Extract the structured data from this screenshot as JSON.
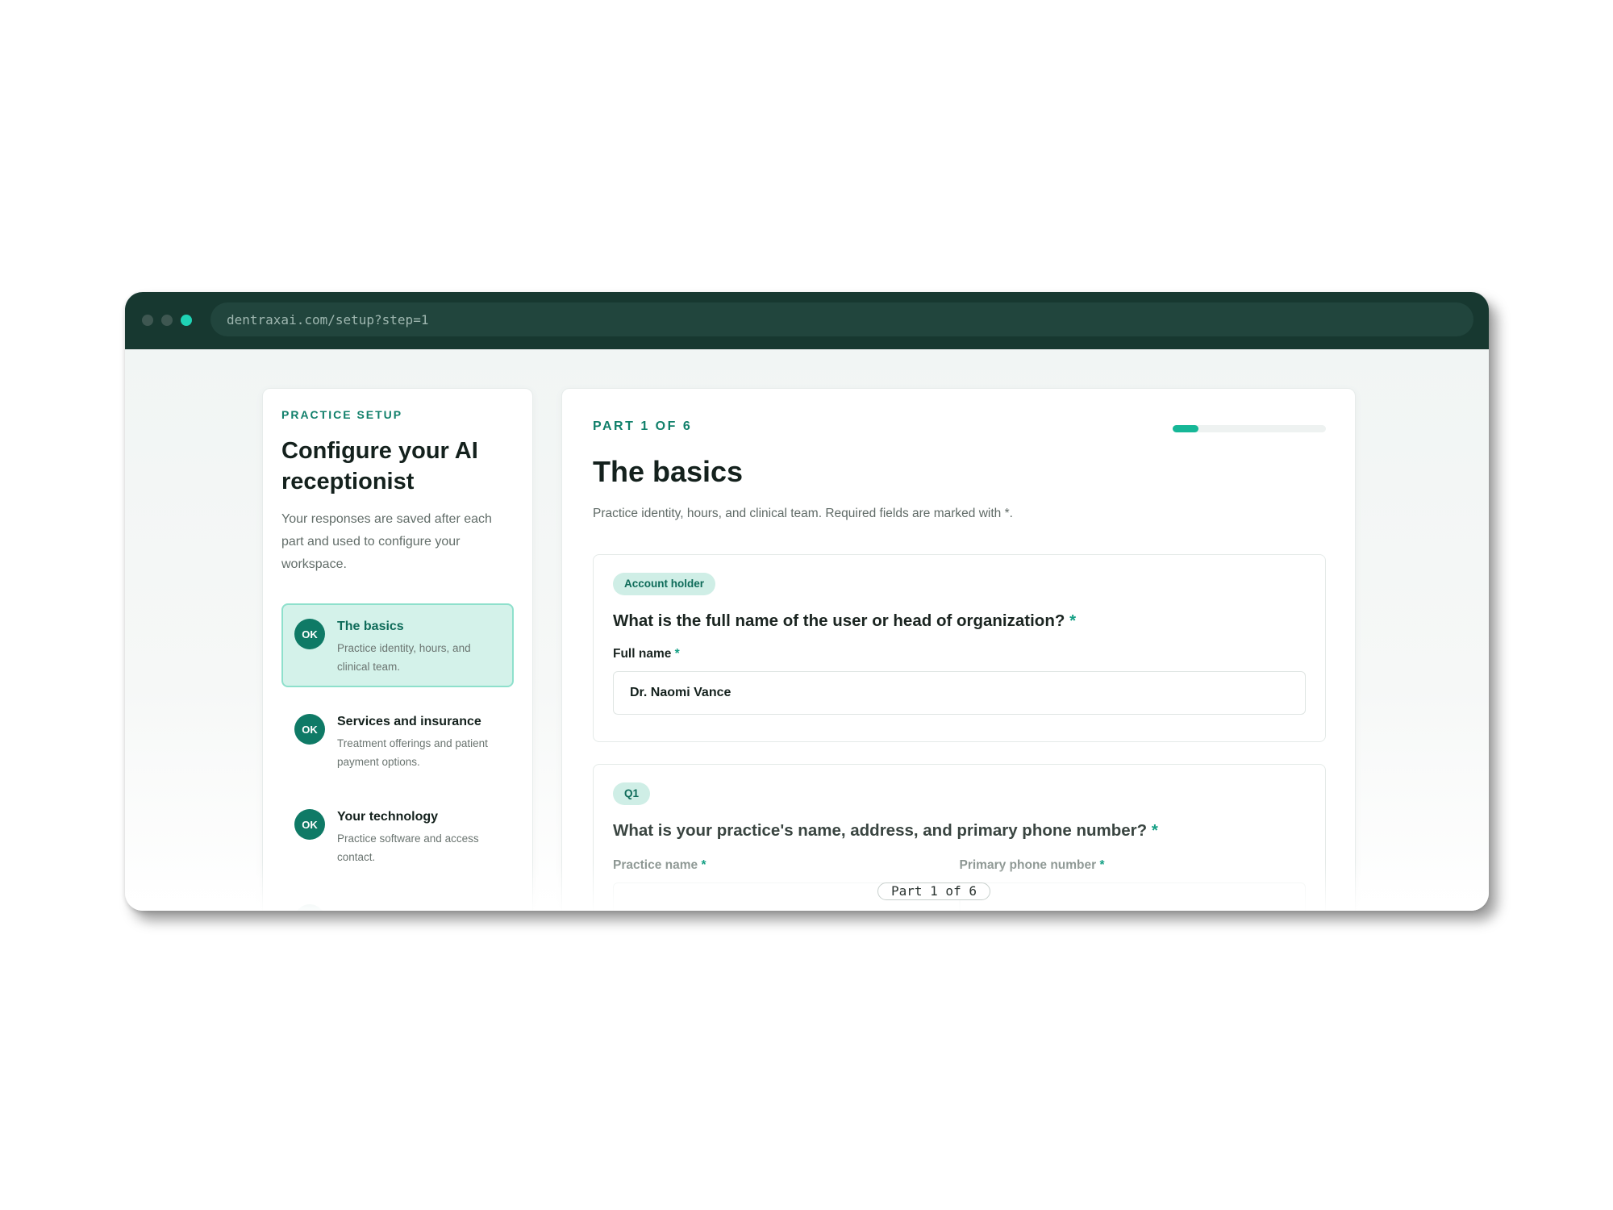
{
  "browser": {
    "url": "dentraxai.com/setup?step=1"
  },
  "sidebar": {
    "eyebrow": "PRACTICE SETUP",
    "title": "Configure your AI receptionist",
    "description": "Your responses are saved after each part and used to configure your workspace.",
    "steps": [
      {
        "badge": "OK",
        "title": "The basics",
        "subtitle": "Practice identity, hours, and clinical team.",
        "active": true
      },
      {
        "badge": "OK",
        "title": "Services and insurance",
        "subtitle": "Treatment offerings and patient payment options.",
        "active": false
      },
      {
        "badge": "OK",
        "title": "Your technology",
        "subtitle": "Practice software and access contact.",
        "active": false
      }
    ]
  },
  "main": {
    "part_label": "PART 1 OF 6",
    "progress_fraction": 0.1667,
    "title": "The basics",
    "description": "Practice identity, hours, and clinical team. Required fields are marked with *.",
    "account_card": {
      "tag": "Account holder",
      "question": "What is the full name of the user or head of organization?",
      "required_mark": "*",
      "field_label": "Full name",
      "field_value": "Dr. Naomi Vance"
    },
    "q1_card": {
      "tag": "Q1",
      "question": "What is your practice's name, address, and primary phone number?",
      "required_mark": "*",
      "practice_name_label": "Practice name",
      "phone_label": "Primary phone number"
    }
  },
  "overlay": {
    "part_chip": "Part 1 of 6"
  },
  "colors": {
    "titlebar": "#173830",
    "accent": "#11806b",
    "accent_light": "#d4f2ea",
    "progress_fill": "#16b797",
    "traffic_active": "#1fd3b5"
  }
}
